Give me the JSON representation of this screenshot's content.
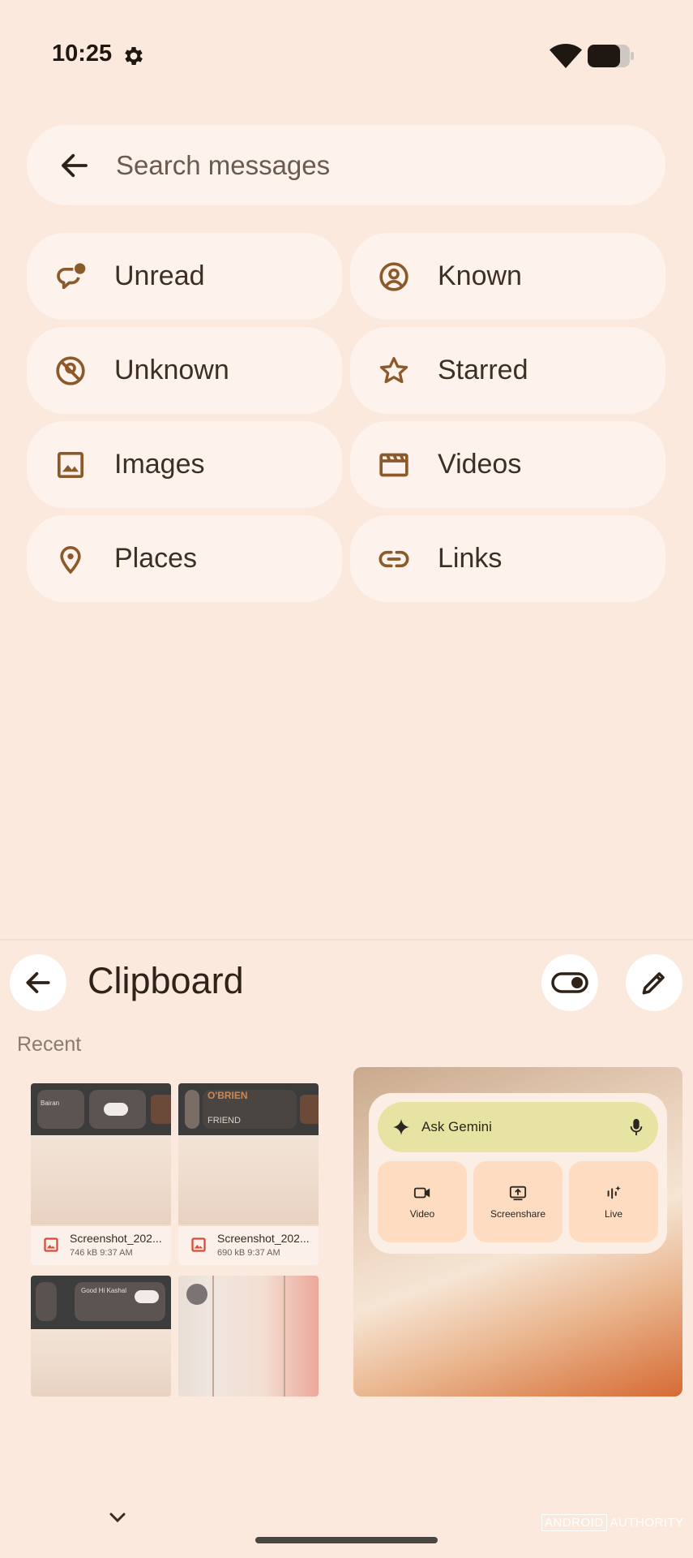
{
  "status_bar": {
    "time": "10:25",
    "icons": [
      "gear-icon",
      "wifi-icon",
      "battery-icon"
    ]
  },
  "search": {
    "placeholder": "Search messages",
    "back_icon": "arrow-left-icon"
  },
  "filters": [
    {
      "label": "Unread",
      "icon": "unread-chat-icon"
    },
    {
      "label": "Known",
      "icon": "account-circle-icon"
    },
    {
      "label": "Unknown",
      "icon": "unknown-person-icon"
    },
    {
      "label": "Starred",
      "icon": "star-icon"
    },
    {
      "label": "Images",
      "icon": "image-icon"
    },
    {
      "label": "Videos",
      "icon": "movie-icon"
    },
    {
      "label": "Places",
      "icon": "location-pin-icon"
    },
    {
      "label": "Links",
      "icon": "link-icon"
    }
  ],
  "clipboard": {
    "title": "Clipboard",
    "section": "Recent",
    "items": [
      {
        "name": "Screenshot_202...",
        "meta": "746 kB 9:37 AM"
      },
      {
        "name": "Screenshot_202...",
        "meta": "690 kB 9:37 AM"
      }
    ],
    "thumb_texts": {
      "a": "Bairan",
      "b": "O'BRIEN",
      "c": "FRIEND",
      "d": "Good Hi Kashal"
    },
    "gemini": {
      "ask": "Ask Gemini",
      "buttons": [
        "Video",
        "Screenshare",
        "Live"
      ]
    }
  },
  "colors": {
    "background": "#fbe9dd",
    "chip": "#fdf3ec",
    "icon_brown": "#8b5a2b",
    "gemini_bar": "#e6e3a3"
  },
  "watermark": {
    "a": "ANDROID",
    "b": "AUTHORITY"
  }
}
